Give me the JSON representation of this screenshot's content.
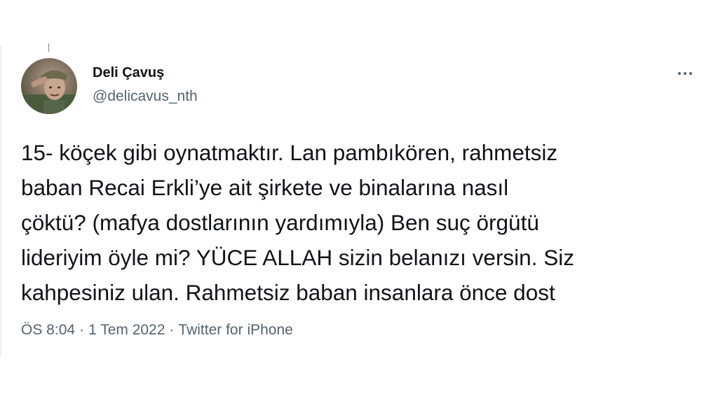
{
  "tweet": {
    "display_name": "Deli Çavuş",
    "handle": "@delicavus_nth",
    "lines": [
      "15- köçek gibi oynatmaktır. Lan pambıkören, rahmetsiz",
      "baban Recai Erkli’ye ait şirkete ve binalarına nasıl",
      "çöktü? (mafya dostlarının yardımıyla) Ben suç örgütü",
      "lideriyim öyle mi? YÜCE ALLAH sizin belanızı versin. Siz",
      "kahpesiniz ulan. Rahmetsiz baban insanlara önce dost"
    ],
    "time": "ÖS 8:04",
    "date": "1 Tem 2022",
    "source": "Twitter for iPhone",
    "separator": "·",
    "more_icon": "more-horizontal-icon"
  },
  "colors": {
    "text_primary": "#0f1419",
    "text_secondary": "#536471"
  }
}
